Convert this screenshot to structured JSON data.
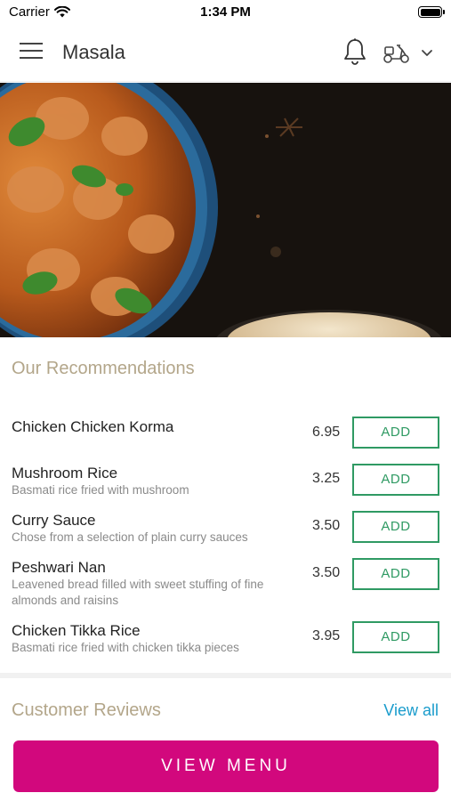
{
  "status_bar": {
    "carrier": "Carrier",
    "time": "1:34 PM"
  },
  "header": {
    "title": "Masala",
    "icons": {
      "menu": "hamburger-icon",
      "notifications": "bell-icon",
      "delivery": "scooter-icon",
      "dropdown": "chevron-down-icon"
    }
  },
  "recommendations": {
    "title": "Our Recommendations",
    "items": [
      {
        "name": "Chicken Chicken Korma",
        "description": "",
        "price": "6.95",
        "button": "ADD"
      },
      {
        "name": "Mushroom Rice",
        "description": "Basmati rice fried with mushroom",
        "price": "3.25",
        "button": "ADD"
      },
      {
        "name": "Curry Sauce",
        "description": "Chose from a selection of plain curry sauces",
        "price": "3.50",
        "button": "ADD"
      },
      {
        "name": "Peshwari Nan",
        "description": "Leavened bread filled with sweet stuffing of fine almonds and raisins",
        "price": "3.50",
        "button": "ADD"
      },
      {
        "name": "Chicken Tikka Rice",
        "description": "Basmati rice fried with chicken tikka pieces",
        "price": "3.95",
        "button": "ADD"
      }
    ]
  },
  "reviews": {
    "title": "Customer Reviews",
    "view_all": "View all"
  },
  "footer": {
    "view_menu": "VIEW MENU"
  },
  "colors": {
    "accent_magenta": "#d2087d",
    "add_green": "#2f9a63",
    "link_blue": "#1a9ccc",
    "section_title": "#b3a68a"
  }
}
